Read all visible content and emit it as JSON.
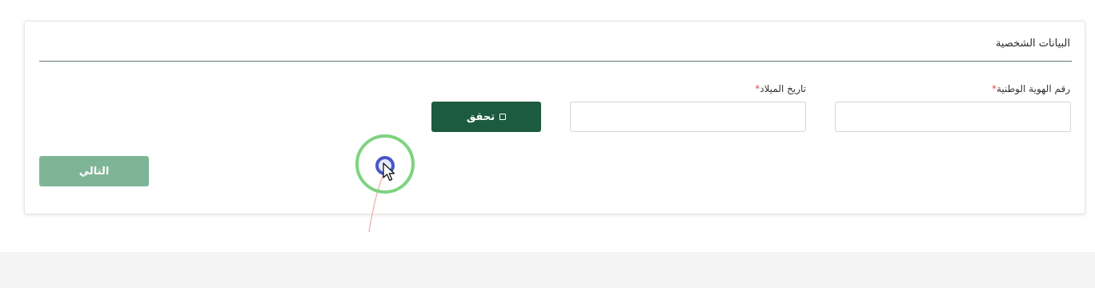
{
  "form": {
    "section_title": "البيانات الشخصية",
    "national_id": {
      "label": "رقم الهوية الوطنية",
      "required_mark": "*",
      "value": ""
    },
    "birthdate": {
      "label": "تاريخ الميلاد",
      "required_mark": "*",
      "value": ""
    },
    "verify_button": {
      "label": "تحقق",
      "icon": "square-icon"
    },
    "next_button": {
      "label": "التالي"
    }
  },
  "colors": {
    "primary": "#1c5b3f",
    "next_disabled": "#7fb597",
    "divider": "#5f7d6a",
    "required": "#d9534f",
    "cursor_ring": "#7ed37f",
    "cursor_dot": "#4a55c8"
  }
}
